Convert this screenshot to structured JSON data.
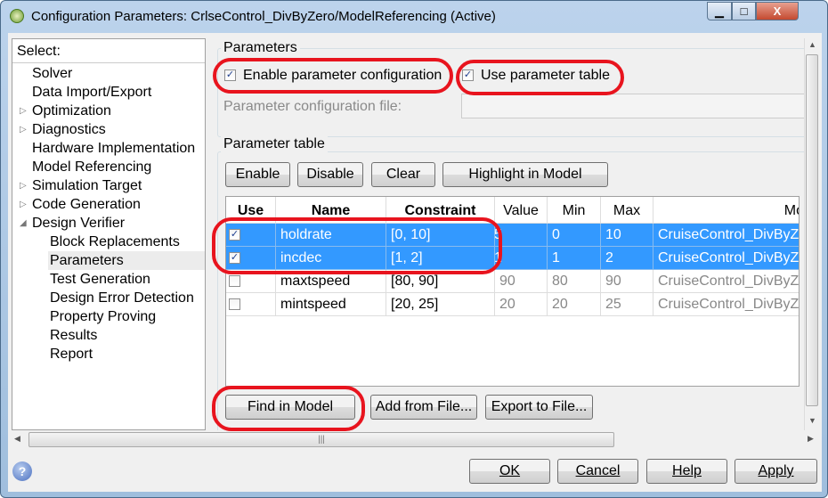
{
  "window": {
    "title": "Configuration Parameters: CrlseControl_DivByZero/ModelReferencing (Active)",
    "minimize": "▁",
    "maximize": "□",
    "close": "X"
  },
  "tree": {
    "header": "Select:",
    "items": [
      {
        "label": "Solver",
        "level": 0,
        "expander": false
      },
      {
        "label": "Data Import/Export",
        "level": 0,
        "expander": false
      },
      {
        "label": "Optimization",
        "level": 0,
        "expander": "collapsed"
      },
      {
        "label": "Diagnostics",
        "level": 0,
        "expander": "collapsed"
      },
      {
        "label": "Hardware Implementation",
        "level": 0,
        "expander": false
      },
      {
        "label": "Model Referencing",
        "level": 0,
        "expander": false
      },
      {
        "label": "Simulation Target",
        "level": 0,
        "expander": "collapsed"
      },
      {
        "label": "Code Generation",
        "level": 0,
        "expander": "collapsed"
      },
      {
        "label": "Design Verifier",
        "level": 0,
        "expander": "expanded"
      },
      {
        "label": "Block Replacements",
        "level": 1
      },
      {
        "label": "Parameters",
        "level": 1,
        "selected": true
      },
      {
        "label": "Test Generation",
        "level": 1
      },
      {
        "label": "Design Error Detection",
        "level": 1
      },
      {
        "label": "Property Proving",
        "level": 1
      },
      {
        "label": "Results",
        "level": 1
      },
      {
        "label": "Report",
        "level": 1
      }
    ]
  },
  "parameters": {
    "group_label": "Parameters",
    "enable_config": {
      "label": "Enable parameter configuration",
      "checked": true
    },
    "use_table": {
      "label": "Use parameter table",
      "checked": true
    },
    "config_file_label": "Parameter configuration file:",
    "config_file_value": ""
  },
  "param_table": {
    "group_label": "Parameter table",
    "buttons": [
      "Enable",
      "Disable",
      "Clear",
      "Highlight in Model"
    ],
    "columns": [
      "Use",
      "Name",
      "Constraint",
      "Value",
      "Min",
      "Max",
      "Mo"
    ],
    "rows": [
      {
        "use": true,
        "name": "holdrate",
        "constraint": "[0, 10]",
        "value": "5",
        "min": "0",
        "max": "10",
        "model": "CruiseControl_DivByZe",
        "selected": true
      },
      {
        "use": true,
        "name": "incdec",
        "constraint": "[1, 2]",
        "value": "1",
        "min": "1",
        "max": "2",
        "model": "CruiseControl_DivByZe",
        "selected": true
      },
      {
        "use": false,
        "name": "maxtspeed",
        "constraint": "[80, 90]",
        "value": "90",
        "min": "80",
        "max": "90",
        "model": "CruiseControl_DivByZe",
        "selected": false
      },
      {
        "use": false,
        "name": "mintspeed",
        "constraint": "[20, 25]",
        "value": "20",
        "min": "20",
        "max": "25",
        "model": "CruiseControl_DivByZe",
        "selected": false
      }
    ],
    "bottom_buttons": [
      "Find in Model",
      "Add from File...",
      "Export to File..."
    ]
  },
  "footer": {
    "ok": "OK",
    "cancel": "Cancel",
    "help": "Help",
    "apply": "Apply"
  },
  "colors": {
    "selection": "#3399ff",
    "highlight_ring": "#e8141e"
  }
}
